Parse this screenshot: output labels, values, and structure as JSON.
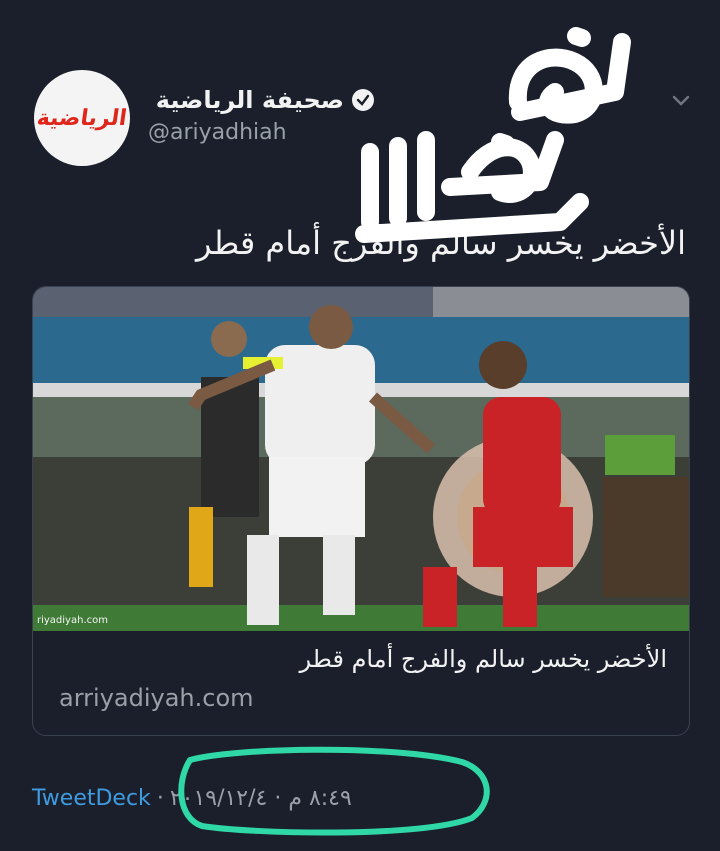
{
  "account": {
    "avatar_logo": "الرياضية",
    "display_name": "صحيفة الرياضية",
    "handle": "@ariyadhiah",
    "verified_icon": "verified-badge-icon",
    "menu_icon": "chevron-down-icon"
  },
  "overlay": {
    "handwritten_word": "فزناااا"
  },
  "tweet": {
    "text": "الأخضر يخسر سالم والفرج أمام قطر"
  },
  "card": {
    "image_watermark": "riyadiyah.com",
    "title": "الأخضر يخسر سالم والفرج أمام قطر",
    "domain": "arriyadiyah.com"
  },
  "meta": {
    "source": "TweetDeck",
    "separator": "·",
    "timestamp": "٨:٤٩ م · ٢٠١٩/١٢/٤"
  },
  "colors": {
    "background": "#1a1f2b",
    "link": "#3f9be0",
    "highlight": "#2fd8a6",
    "logo_red": "#e0261b"
  }
}
